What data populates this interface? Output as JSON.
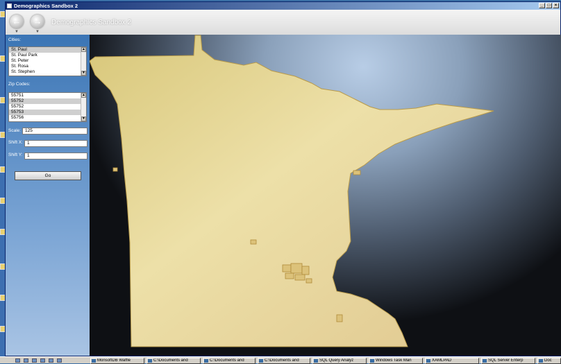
{
  "window": {
    "title": "Demographics Sandbox 2",
    "controls": [
      "_",
      "□",
      "×"
    ]
  },
  "nav": {
    "back_icon": "back-arrow-icon",
    "forward_icon": "forward-arrow-icon",
    "title": "Demographics Sandbox 2"
  },
  "sidebar": {
    "cities_label": "Cities:",
    "cities": [
      "St. Paul",
      "St. Paul Park",
      "St. Peter",
      "St. Rosa",
      "St. Stephen"
    ],
    "zip_label": "Zip Codes:",
    "zips": [
      "55751",
      "55752",
      "55752",
      "55753",
      "55756"
    ],
    "scale_label": "Scale:",
    "scale_value": "125",
    "shiftx_label": "Shift X:",
    "shiftx_value": "1",
    "shifty_label": "Shift Y:",
    "shifty_value": "1",
    "go_label": "Go"
  },
  "map": {
    "region": "Minnesota",
    "fill_color": "#e8d596",
    "stroke_color": "#b89a4a"
  },
  "taskbar": {
    "items": [
      "MonsoftDB Waffle",
      "C:\\Documents and",
      "C:\\Documents and",
      "C:\\Documents and",
      "SQL Query Analyz",
      "Windows Task Man",
      "XAMLPAD",
      "SQL Server Enterp",
      "Doc"
    ]
  },
  "colors": {
    "accent": "#0a246a",
    "sidebar": "#5a8cc8"
  }
}
